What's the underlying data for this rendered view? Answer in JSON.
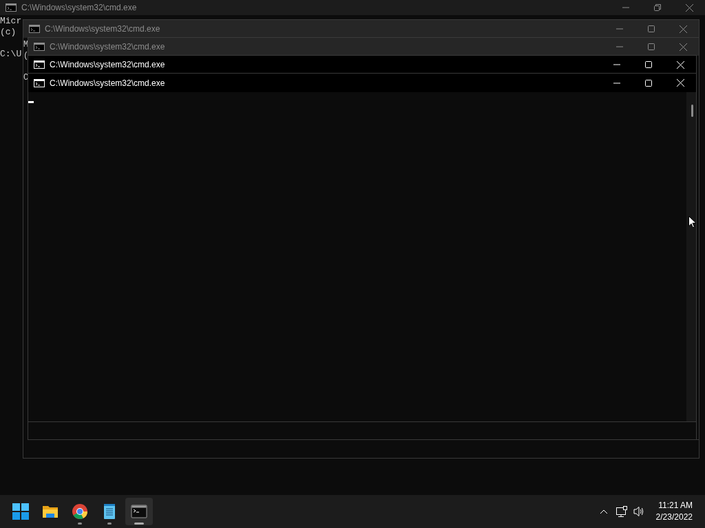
{
  "windows": [
    {
      "title": "C:\\Windows\\system32\\cmd.exe",
      "active": false,
      "maximized": true,
      "lines": [
        "Micr",
        "(c)"
      ],
      "prompt": "C:\\U"
    },
    {
      "title": "C:\\Windows\\system32\\cmd.exe",
      "active": false,
      "maximized": false,
      "lines": [
        "M",
        "("
      ],
      "prompt": "C"
    },
    {
      "title": "C:\\Windows\\system32\\cmd.exe",
      "active": false,
      "maximized": false
    },
    {
      "title": "C:\\Windows\\system32\\cmd.exe",
      "active": true,
      "maximized": false
    },
    {
      "title": "C:\\Windows\\system32\\cmd.exe",
      "active": true,
      "maximized": false,
      "cursor": true
    }
  ],
  "taskbar": {
    "apps": [
      {
        "kind": "start",
        "running": false,
        "selected": false
      },
      {
        "kind": "folder",
        "running": false,
        "selected": false
      },
      {
        "kind": "browser",
        "running": true,
        "selected": false
      },
      {
        "kind": "notepad",
        "running": true,
        "selected": false
      },
      {
        "kind": "terminal",
        "running": true,
        "selected": true
      }
    ],
    "time": "11:21 AM",
    "date": "2/23/2022"
  }
}
